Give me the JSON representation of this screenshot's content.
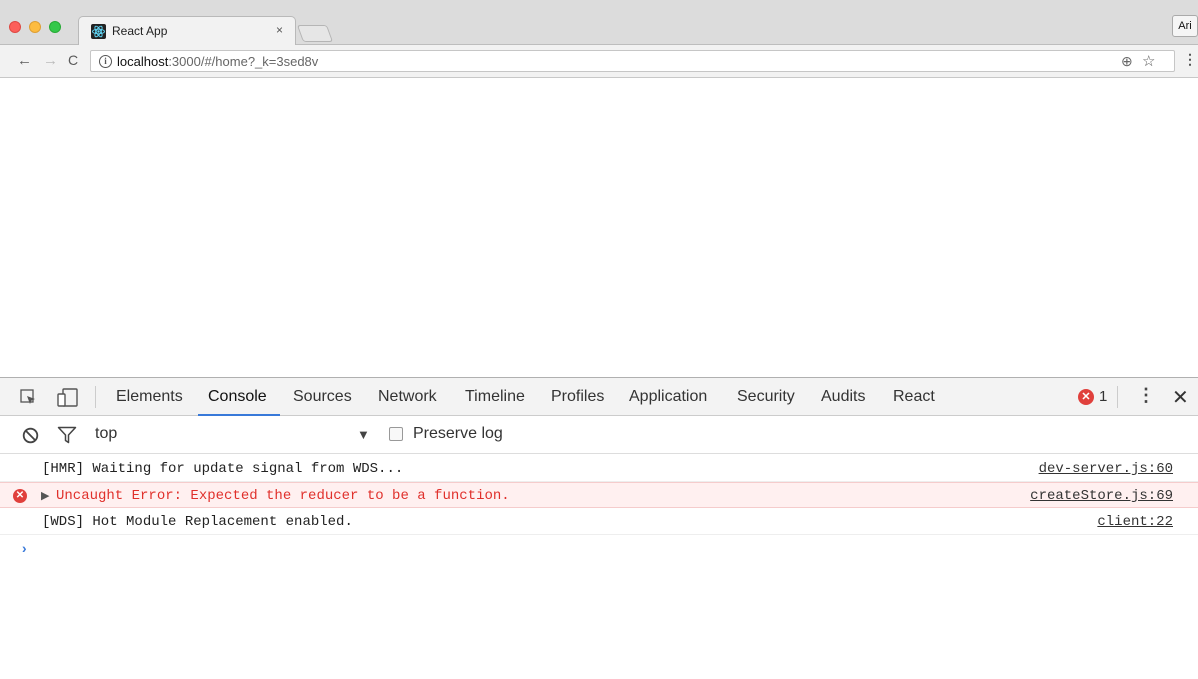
{
  "browser": {
    "tab_title": "React App",
    "tab_close": "×",
    "profile": "Ari",
    "url_host": "localhost",
    "url_path": ":3000/#/home?_k=3sed8v"
  },
  "devtools": {
    "tabs": [
      {
        "label": "Elements"
      },
      {
        "label": "Console"
      },
      {
        "label": "Sources"
      },
      {
        "label": "Network"
      },
      {
        "label": "Timeline"
      },
      {
        "label": "Profiles"
      },
      {
        "label": "Application"
      },
      {
        "label": "Security"
      },
      {
        "label": "Audits"
      },
      {
        "label": "React"
      }
    ],
    "active_tab": "Console",
    "error_count": "1",
    "context": "top",
    "preserve_log_label": "Preserve log",
    "messages": [
      {
        "type": "log",
        "text": "[HMR] Waiting for update signal from WDS...",
        "source": "dev-server.js:60"
      },
      {
        "type": "error",
        "text": "Uncaught Error: Expected the reducer to be a function.",
        "source": "createStore.js:69"
      },
      {
        "type": "log",
        "text": "[WDS] Hot Module Replacement enabled.",
        "source": "client:22"
      }
    ],
    "prompt": "›"
  },
  "colors": {
    "accent": "#3879d9",
    "error": "#e0302b",
    "error_bg": "#fff0f0"
  }
}
